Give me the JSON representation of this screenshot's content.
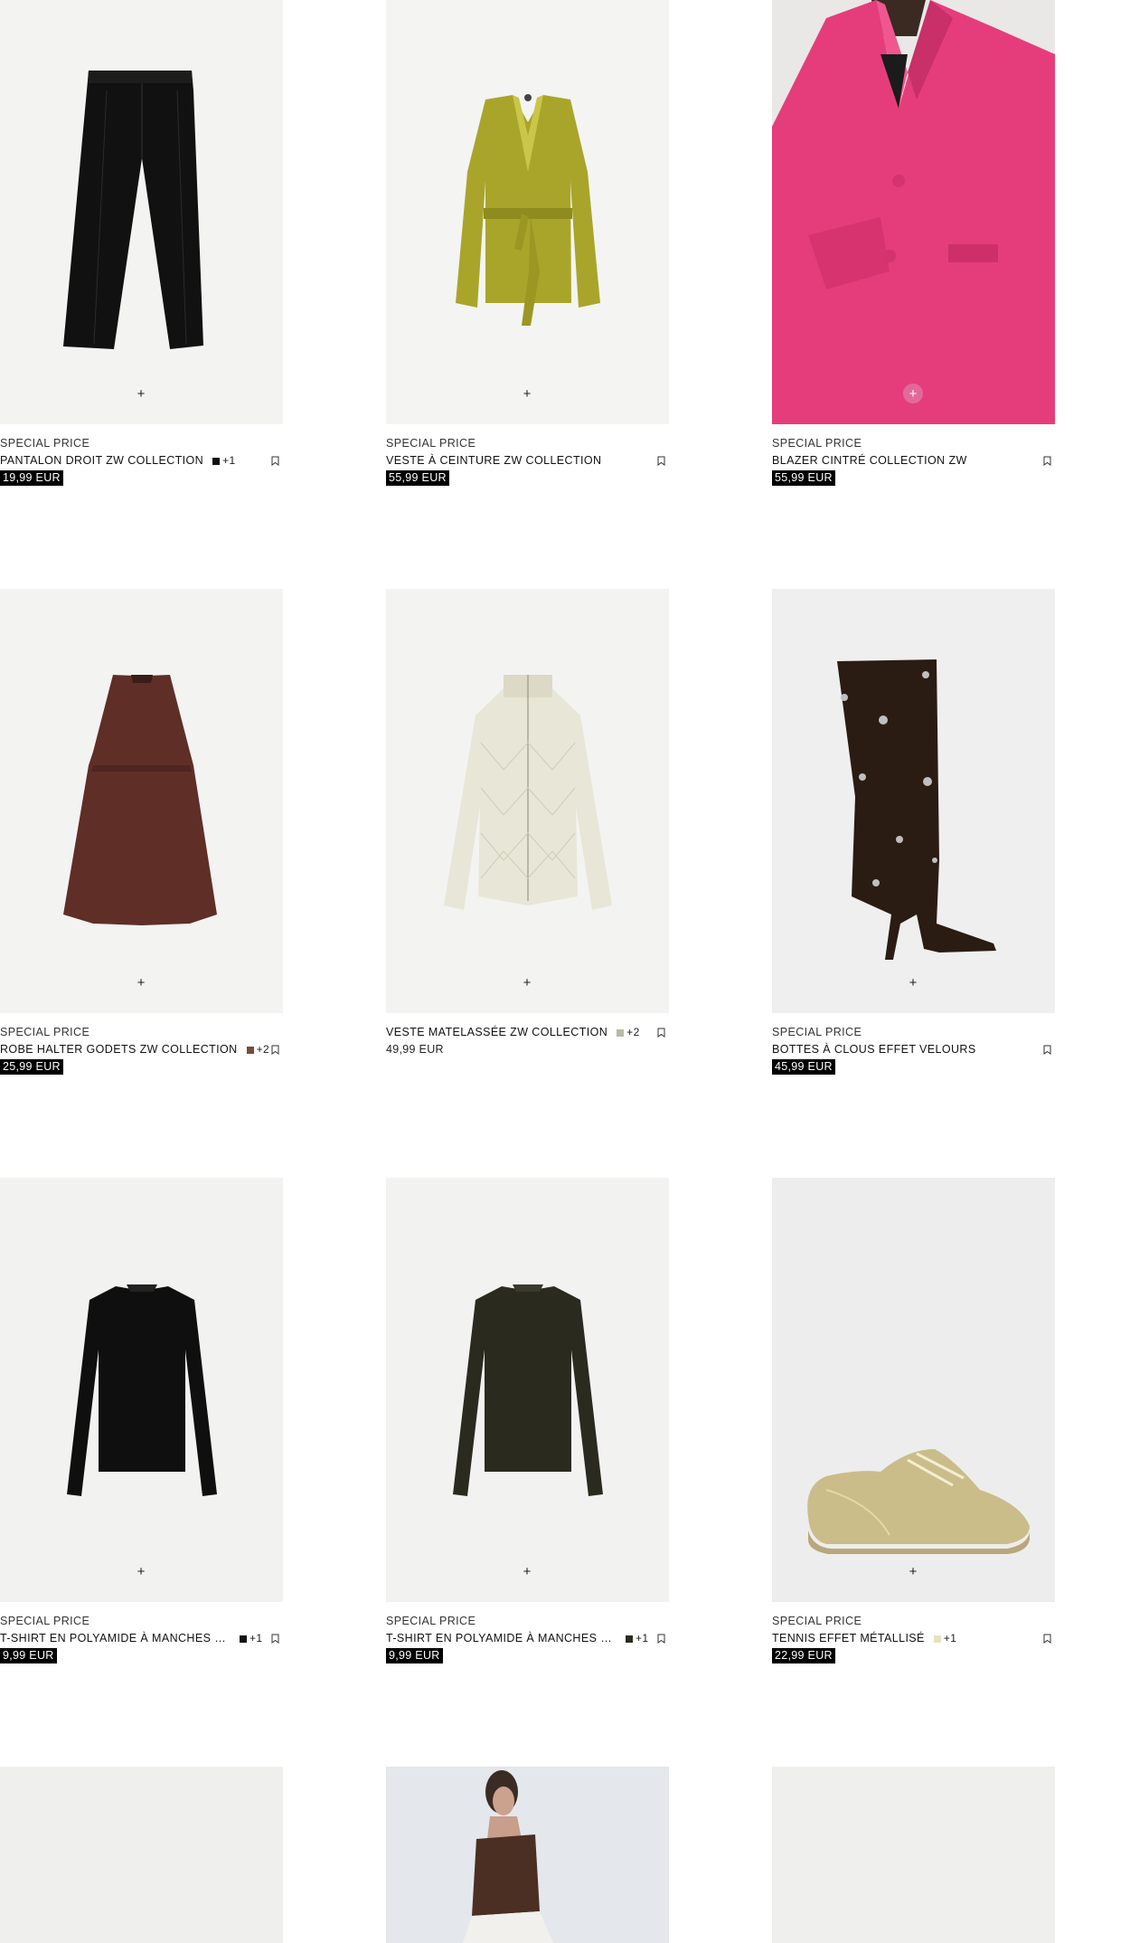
{
  "products": [
    {
      "tag": "SPECIAL PRICE",
      "name": "PANTALON DROIT ZW COLLECTION",
      "swatch": "#111111",
      "more": "+1",
      "price": "19,99 EUR",
      "promo": true,
      "image": "black-trousers"
    },
    {
      "tag": "SPECIAL PRICE",
      "name": "VESTE À CEINTURE ZW COLLECTION",
      "swatch": "",
      "more": "",
      "price": "55,99 EUR",
      "promo": true,
      "image": "belted-jacket"
    },
    {
      "tag": "SPECIAL PRICE",
      "name": "BLAZER CINTRÉ COLLECTION ZW",
      "swatch": "",
      "more": "",
      "price": "55,99 EUR",
      "promo": true,
      "image": "pink-blazer-model"
    },
    {
      "tag": "SPECIAL PRICE",
      "name": "ROBE HALTER GODETS ZW COLLECTION",
      "swatch": "#7a4a3c",
      "more": "+2",
      "price": "25,99 EUR",
      "promo": true,
      "image": "halter-dress"
    },
    {
      "tag": "",
      "name": "VESTE MATELASSÉE ZW COLLECTION",
      "swatch": "#b7bca0",
      "more": "+2",
      "price": "49,99 EUR",
      "promo": false,
      "image": "quilted-jacket"
    },
    {
      "tag": "SPECIAL PRICE",
      "name": "BOTTES À CLOUS EFFET VELOURS",
      "swatch": "",
      "more": "",
      "price": "45,99 EUR",
      "promo": true,
      "image": "studded-boot"
    },
    {
      "tag": "SPECIAL PRICE",
      "name": "T-SHIRT EN POLYAMIDE À MANCHES L...",
      "swatch": "#111111",
      "more": "+1",
      "price": "9,99 EUR",
      "promo": true,
      "image": "black-longsleeve"
    },
    {
      "tag": "SPECIAL PRICE",
      "name": "T-SHIRT EN POLYAMIDE À MANCHES L...",
      "swatch": "#2a2a22",
      "more": "+1",
      "price": "9,99 EUR",
      "promo": true,
      "image": "olive-longsleeve"
    },
    {
      "tag": "SPECIAL PRICE",
      "name": "TENNIS EFFET MÉTALLISÉ",
      "swatch": "#e6e2bf",
      "more": "+1",
      "price": "22,99 EUR",
      "promo": true,
      "image": "metallic-sneaker"
    },
    {
      "tag": "",
      "name": "",
      "swatch": "",
      "more": "",
      "price": "",
      "promo": false,
      "image": "blank"
    },
    {
      "tag": "",
      "name": "",
      "swatch": "",
      "more": "",
      "price": "",
      "promo": false,
      "image": "model-brown-top"
    },
    {
      "tag": "",
      "name": "",
      "swatch": "",
      "more": "",
      "price": "",
      "promo": false,
      "image": "blank"
    }
  ],
  "quick_add_symbol": "+",
  "icons": {
    "quick_add": "plus-icon",
    "bookmark": "bookmark-icon"
  },
  "colors": {
    "promo_price_bg": "#000000",
    "promo_price_text": "#ffffff",
    "quick_add_highlight": "#e26a9a"
  }
}
